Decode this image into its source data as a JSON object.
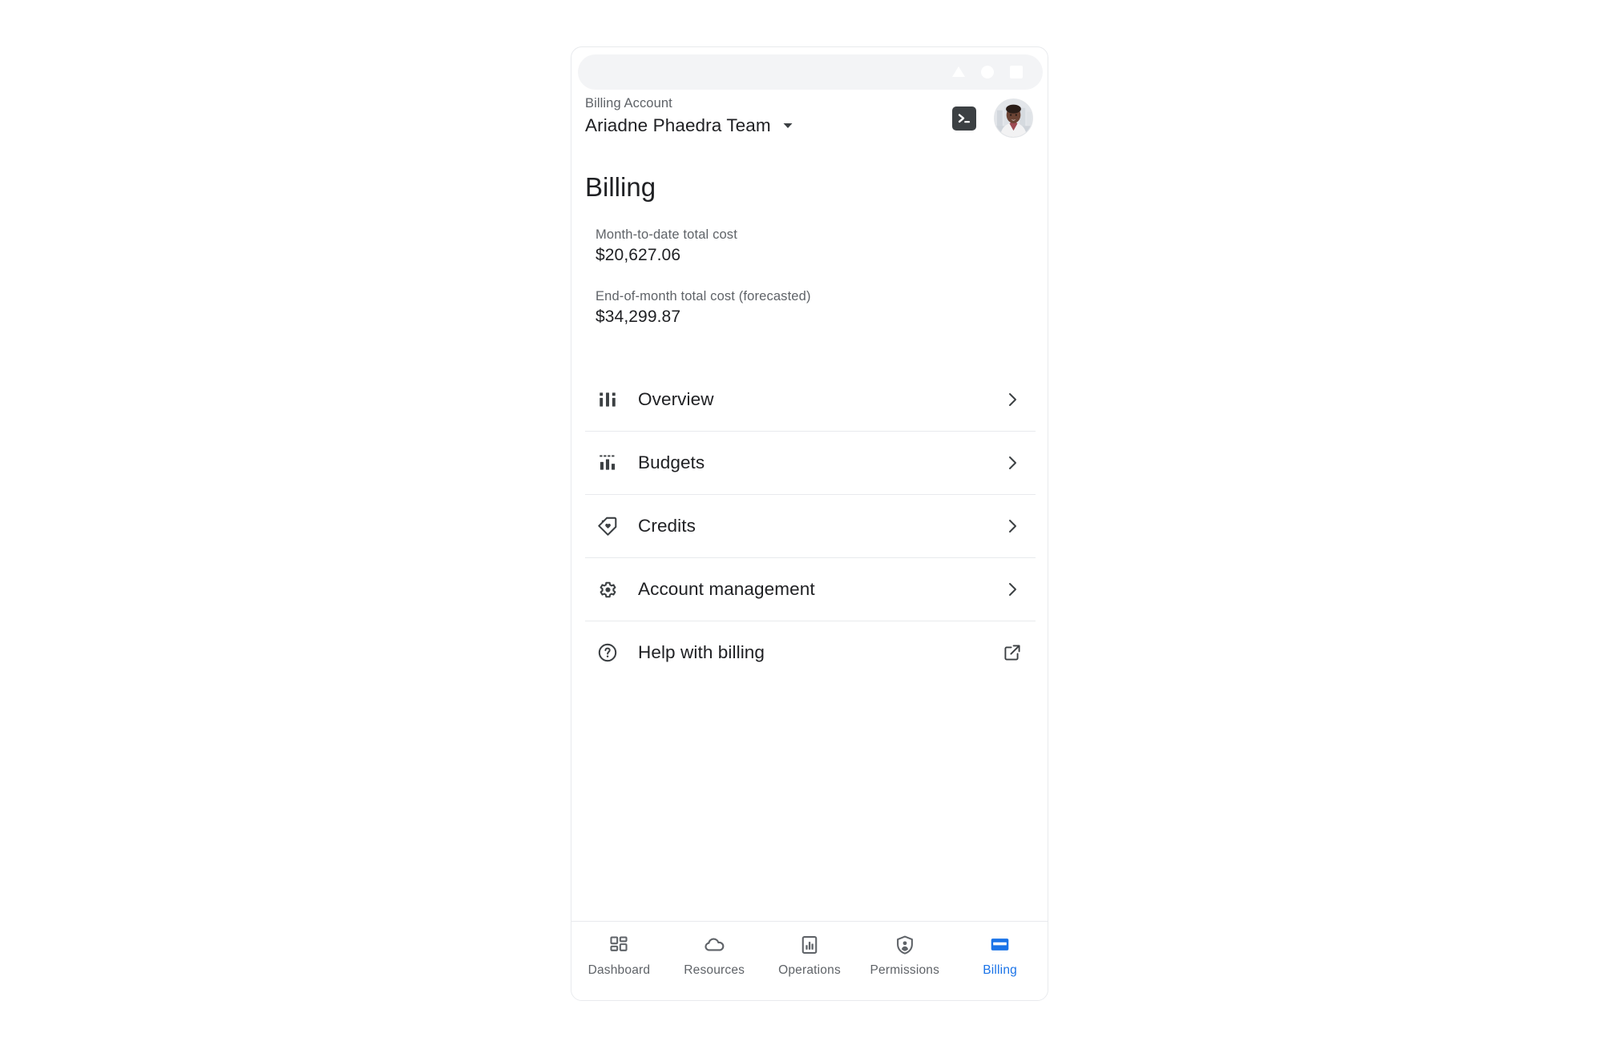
{
  "system_bar": {
    "buttons": [
      {
        "name": "back-button",
        "shape": "triangle"
      },
      {
        "name": "home-button",
        "shape": "circle"
      },
      {
        "name": "recents-button",
        "shape": "square"
      }
    ]
  },
  "header": {
    "account_label": "Billing Account",
    "account_name": "Ariadne Phaedra Team",
    "dropdown_icon": "chevron-down-icon",
    "cloud_shell_icon": "terminal-icon",
    "avatar_icon": "user-avatar"
  },
  "page": {
    "title": "Billing"
  },
  "cost_summary": [
    {
      "label": "Month-to-date total cost",
      "value": "$20,627.06"
    },
    {
      "label": "End-of-month total cost (forecasted)",
      "value": "$34,299.87"
    }
  ],
  "menu": [
    {
      "label": "Overview",
      "icon": "dashboard-bars-icon",
      "trailing_icon": "chevron-right-icon"
    },
    {
      "label": "Budgets",
      "icon": "budget-bar-chart-icon",
      "trailing_icon": "chevron-right-icon"
    },
    {
      "label": "Credits",
      "icon": "loyalty-tag-icon",
      "trailing_icon": "chevron-right-icon"
    },
    {
      "label": "Account management",
      "icon": "gear-icon",
      "trailing_icon": "chevron-right-icon"
    },
    {
      "label": "Help with billing",
      "icon": "help-circle-icon",
      "trailing_icon": "open-in-new-icon"
    }
  ],
  "bottom_nav": {
    "active": "Billing",
    "items": [
      {
        "label": "Dashboard",
        "icon": "grid-dashboard-icon",
        "active": false
      },
      {
        "label": "Resources",
        "icon": "cloud-icon",
        "active": false
      },
      {
        "label": "Operations",
        "icon": "chart-document-icon",
        "active": false
      },
      {
        "label": "Permissions",
        "icon": "shield-person-icon",
        "active": false
      },
      {
        "label": "Billing",
        "icon": "credit-card-icon",
        "active": true
      }
    ]
  },
  "colors": {
    "accent": "#1a73e8",
    "text_primary": "#202124",
    "text_secondary": "#5f6368",
    "divider": "#e8eaed"
  }
}
